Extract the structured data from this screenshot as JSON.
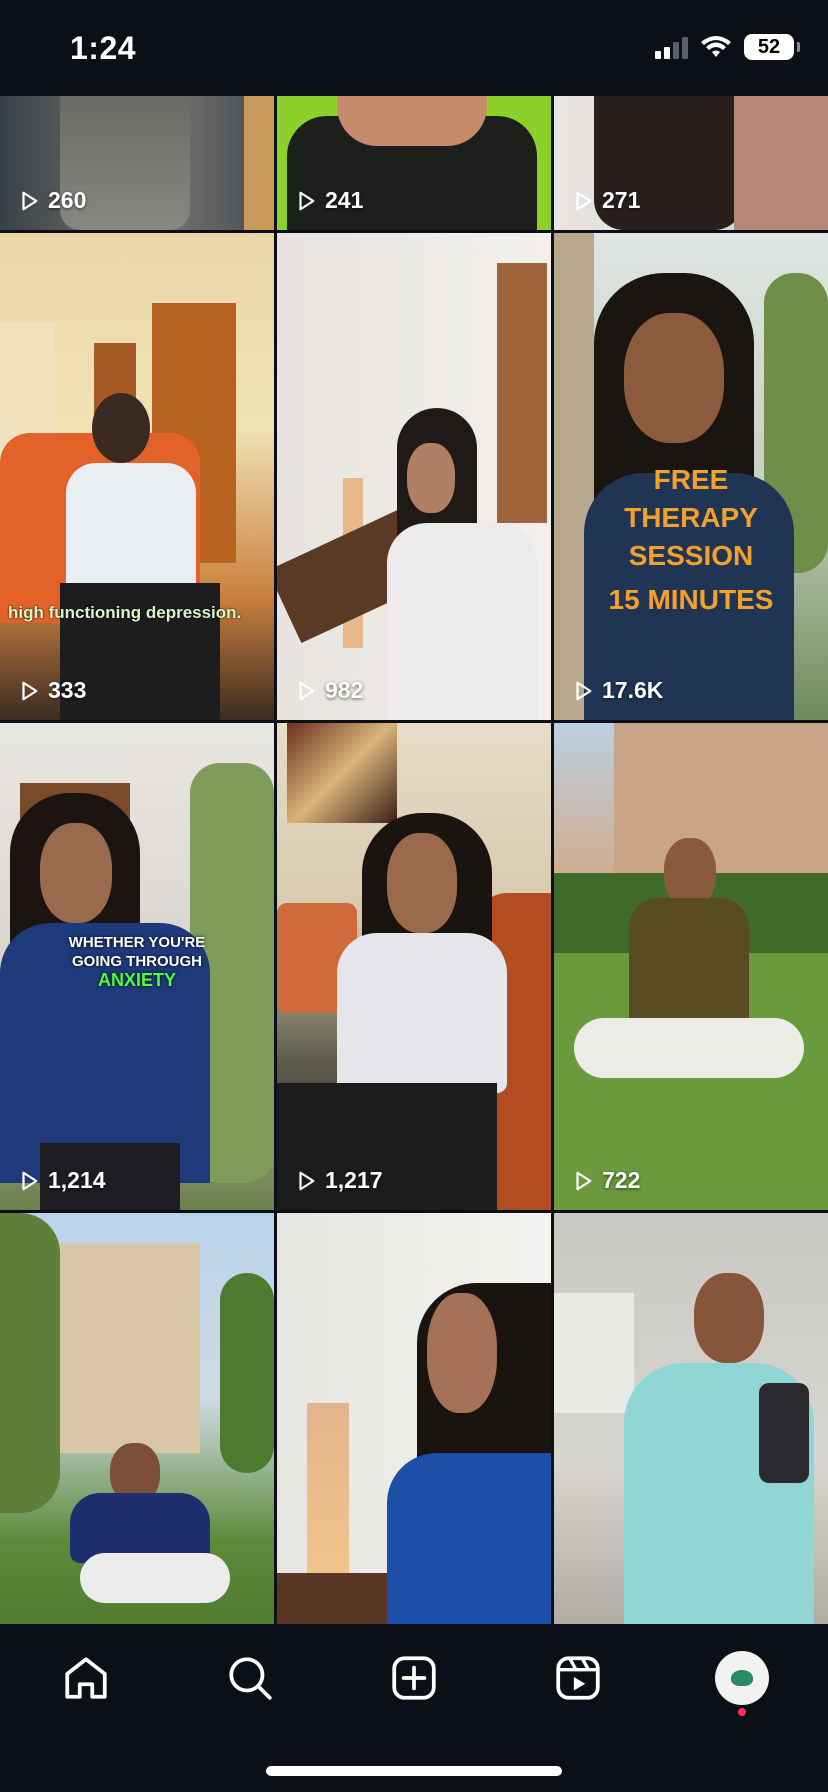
{
  "status": {
    "time": "1:24",
    "battery": "52"
  },
  "grid": {
    "tiles": [
      {
        "views": "260"
      },
      {
        "views": "241"
      },
      {
        "views": "271"
      },
      {
        "views": "333",
        "caption": "high functioning depression."
      },
      {
        "views": "982"
      },
      {
        "views": "17.6K",
        "caption_lines": [
          "FREE",
          "THERAPY",
          "SESSION",
          "15 MINUTES"
        ]
      },
      {
        "views": "1,214",
        "caption_lines": [
          "WHETHER YOU'RE",
          "GOING THROUGH",
          "ANXIETY"
        ]
      },
      {
        "views": "1,217"
      },
      {
        "views": "722"
      },
      {
        "views": ""
      },
      {
        "views": ""
      },
      {
        "views": ""
      }
    ]
  },
  "tabbar": {
    "items": [
      {
        "icon": "home-icon"
      },
      {
        "icon": "search-icon"
      },
      {
        "icon": "add-post-icon"
      },
      {
        "icon": "reels-icon"
      },
      {
        "icon": "profile-avatar"
      }
    ]
  },
  "colors": {
    "accent_orange": "#f3a12a",
    "accent_green": "#4bff3c",
    "caption_green": "#d8f7c8"
  }
}
